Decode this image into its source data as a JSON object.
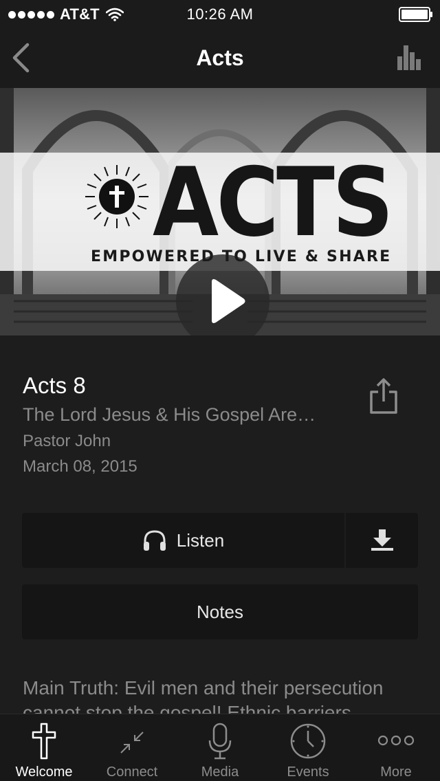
{
  "status_bar": {
    "carrier": "AT&T",
    "time": "10:26 AM"
  },
  "nav": {
    "title": "Acts"
  },
  "hero": {
    "title": "ACTS",
    "subtitle": "EMPOWERED TO LIVE & SHARE"
  },
  "sermon": {
    "title": "Acts 8",
    "subtitle": "The Lord Jesus & His Gospel Are…",
    "speaker": "Pastor John",
    "date": "March 08, 2015",
    "description": "Main Truth: Evil men and their persecution cannot stop the gospel! Ethnic barriers"
  },
  "actions": {
    "listen_label": "Listen",
    "notes_label": "Notes"
  },
  "tabs": [
    {
      "label": "Welcome",
      "icon": "cross-icon",
      "active": true
    },
    {
      "label": "Connect",
      "icon": "collapse-arrows-icon",
      "active": false
    },
    {
      "label": "Media",
      "icon": "microphone-icon",
      "active": false
    },
    {
      "label": "Events",
      "icon": "clock-icon",
      "active": false
    },
    {
      "label": "More",
      "icon": "ellipsis-icon",
      "active": false
    }
  ],
  "colors": {
    "background": "#1d1d1d",
    "bar_background": "#1b1b1b",
    "button_background": "#151515",
    "muted_text": "#8b8b8b",
    "active_tab": "#ffffff",
    "inactive_tab": "#8d8d8d"
  }
}
